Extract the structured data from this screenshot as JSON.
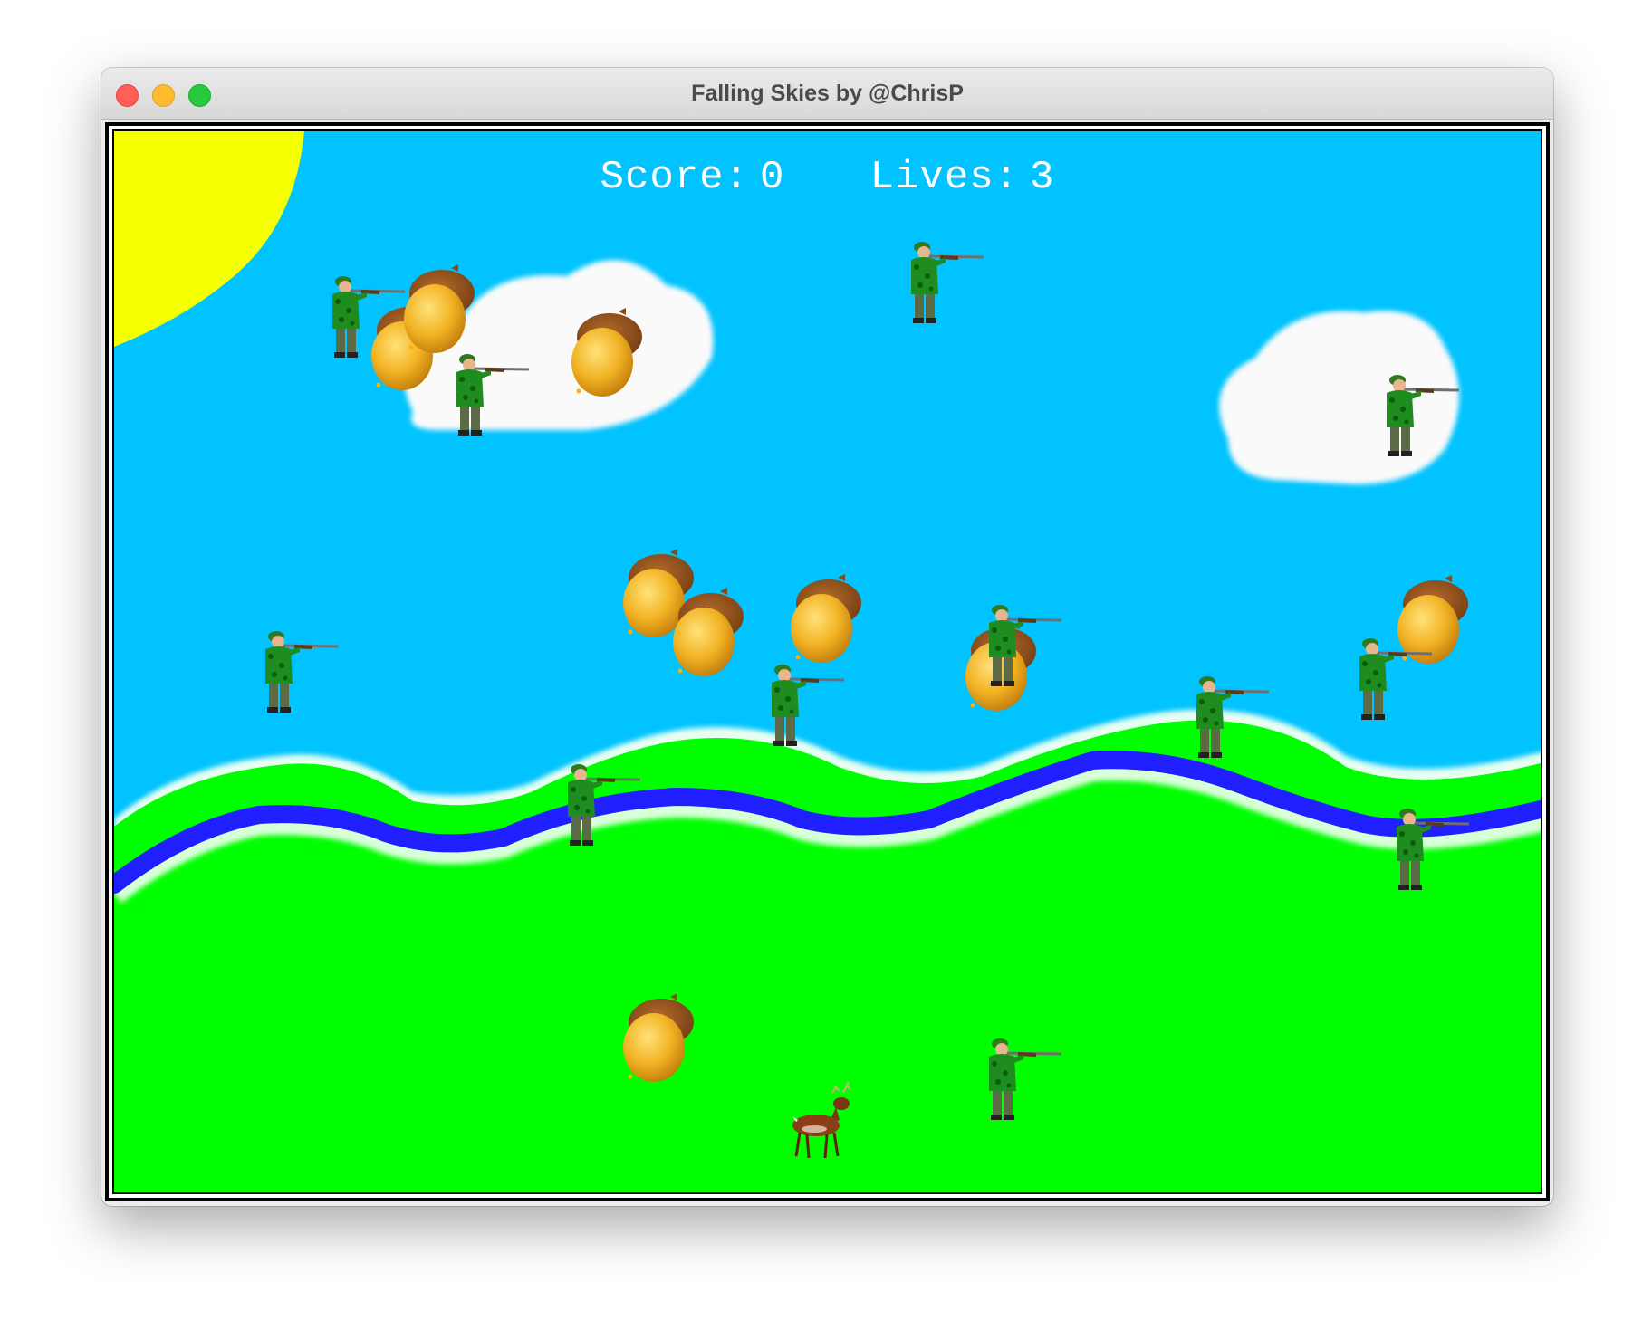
{
  "window": {
    "title": "Falling Skies by @ChrisP",
    "buttons": [
      "close",
      "minimize",
      "zoom"
    ]
  },
  "hud": {
    "score_label": "Score:",
    "score": "0",
    "lives_label": "Lives:",
    "lives": "3"
  },
  "colors": {
    "sky": "#00c3ff",
    "grass": "#00ff00",
    "river": "#1f1fff",
    "sun": "#f4ff00",
    "cloud": "#fafafa"
  },
  "sprites": {
    "player": "deer",
    "enemy": "hunter",
    "pickup": "acorn"
  }
}
